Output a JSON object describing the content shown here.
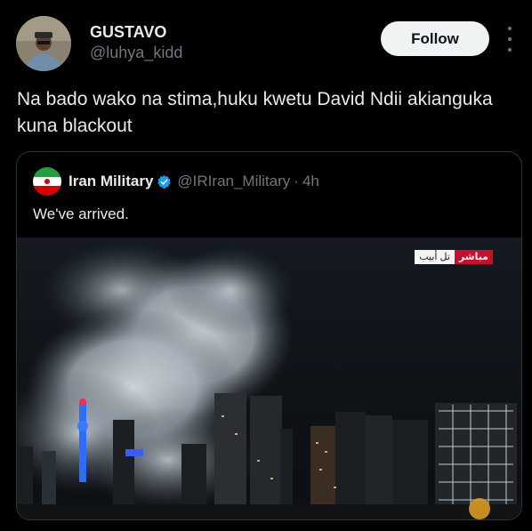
{
  "author": {
    "display_name": "GUSTAVO",
    "handle": "@luhya_kidd",
    "avatar_icon": "user-avatar"
  },
  "actions": {
    "follow_label": "Follow",
    "more_icon": "more-vertical-icon"
  },
  "tweet": {
    "text": "Na bado wako na stima,huku kwetu David Ndii akianguka kuna blackout"
  },
  "quoted": {
    "display_name": "Iran Military",
    "handle": "@IRIran_Military",
    "separator": "·",
    "time": "4h",
    "verified": true,
    "text": "We've arrived.",
    "media": {
      "badge_place": "تل أبيب",
      "badge_live": "مباشر"
    }
  },
  "colors": {
    "background": "#000000",
    "verified": "#1d9bf0",
    "follow_bg": "#eff3f4",
    "secondary_text": "#71767b",
    "badge_red": "#c8102e"
  }
}
